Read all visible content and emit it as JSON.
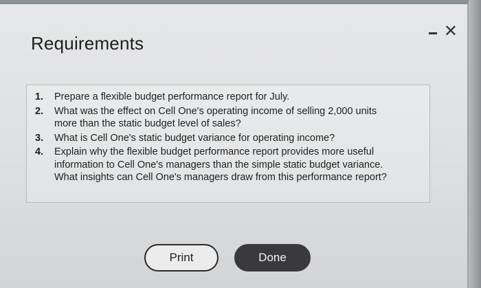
{
  "dialog": {
    "title": "Requirements",
    "minimize_label": "minimize",
    "close_symbol": "✕"
  },
  "requirements": [
    {
      "num": "1.",
      "text": "Prepare a flexible budget performance report for July."
    },
    {
      "num": "2.",
      "text": "What was the effect on Cell One's operating income of selling 2,000 units\nmore than the static budget level of sales?"
    },
    {
      "num": "3.",
      "text": "What is Cell One's static budget variance for operating income?"
    },
    {
      "num": "4.",
      "text": "Explain why the flexible budget performance report provides more useful\ninformation to Cell One's managers than the simple static budget variance.\nWhat insights can Cell One's managers draw from this performance report?"
    }
  ],
  "buttons": {
    "print_label": "Print",
    "done_label": "Done"
  }
}
